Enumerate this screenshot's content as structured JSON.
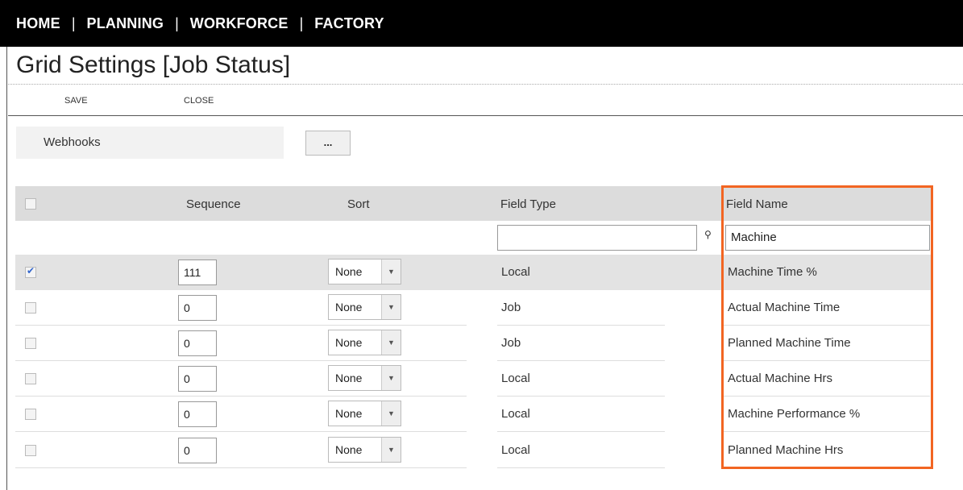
{
  "nav": {
    "items": [
      "HOME",
      "PLANNING",
      "WORKFORCE",
      "FACTORY"
    ],
    "separator": "|"
  },
  "page": {
    "title": "Grid Settings [Job Status]"
  },
  "toolbar": {
    "save_label": "SAVE",
    "close_label": "CLOSE"
  },
  "webhooks": {
    "label": "Webhooks",
    "button_label": "..."
  },
  "grid": {
    "headers": {
      "sequence": "Sequence",
      "sort": "Sort",
      "field_type": "Field Type",
      "field_name": "Field Name"
    },
    "filter": {
      "field_type_value": "",
      "field_name_value": "Machine",
      "filter_icon": "pin-icon"
    },
    "rows": [
      {
        "checked": true,
        "sequence": "111",
        "sort": "None",
        "field_type": "Local",
        "field_name": "Machine Time %"
      },
      {
        "checked": false,
        "sequence": "0",
        "sort": "None",
        "field_type": "Job",
        "field_name": "Actual Machine Time"
      },
      {
        "checked": false,
        "sequence": "0",
        "sort": "None",
        "field_type": "Job",
        "field_name": "Planned Machine Time"
      },
      {
        "checked": false,
        "sequence": "0",
        "sort": "None",
        "field_type": "Local",
        "field_name": "Actual Machine Hrs"
      },
      {
        "checked": false,
        "sequence": "0",
        "sort": "None",
        "field_type": "Local",
        "field_name": "Machine Performance %"
      },
      {
        "checked": false,
        "sequence": "0",
        "sort": "None",
        "field_type": "Local",
        "field_name": "Planned Machine Hrs"
      }
    ]
  },
  "colors": {
    "highlight": "#f26522",
    "nav_bg": "#000000",
    "header_bg": "#dcdcdc",
    "selected_row": "#e3e3e3"
  }
}
